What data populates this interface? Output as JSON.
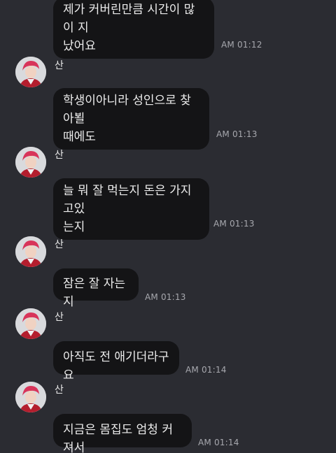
{
  "messages": [
    {
      "text": "제가 커버린만큼 시간이 많이 지\n났어요",
      "time": "AM 01:12"
    },
    {
      "sender": "산",
      "text": "학생이아니라 성인으로 찾아뵐\n때에도",
      "time": "AM 01:13"
    },
    {
      "sender": "산",
      "text": "늘 뭐 잘 먹는지 돈은 가지고있\n는지",
      "time": "AM 01:13"
    },
    {
      "sender": "산",
      "text": "잠은 잘 자는지",
      "time": "AM 01:13"
    },
    {
      "sender": "산",
      "text": "아직도 전 애기더라구요",
      "time": "AM 01:14"
    },
    {
      "sender": "산",
      "text": "지금은 몸집도 엄청 커져서",
      "time": "AM 01:14"
    }
  ],
  "colors": {
    "background": "#2b2c32",
    "bubble": "#141416",
    "text": "#ececec",
    "timestamp": "#a7a8ae",
    "avatar_hair": "#d8345a"
  },
  "icons": {
    "avatar": "profile-photo"
  }
}
